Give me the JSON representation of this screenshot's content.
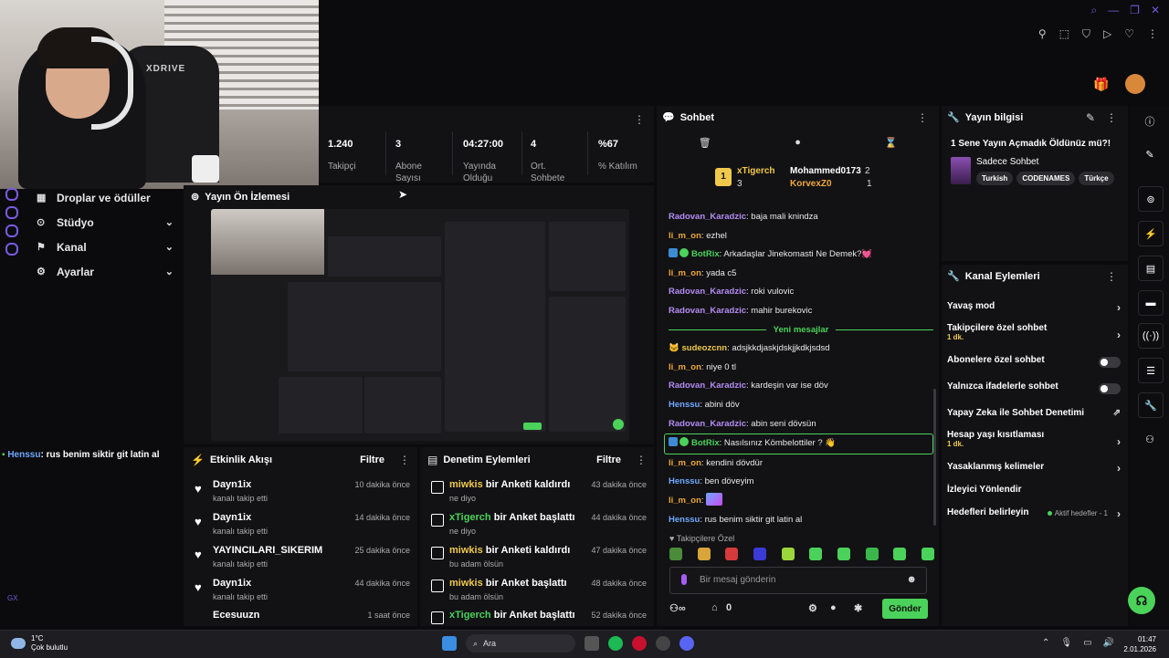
{
  "webcam": {
    "chair_text": "XDRIVE"
  },
  "nav": {
    "items": [
      {
        "label": "Droplar ve ödüller",
        "icon": "gift-icon"
      },
      {
        "label": "Stüdyo",
        "icon": "studio-icon"
      },
      {
        "label": "Kanal",
        "icon": "channel-icon"
      },
      {
        "label": "Ayarlar",
        "icon": "gear-icon"
      }
    ]
  },
  "overlay_chat": {
    "user": "Henssu",
    "message": "rus benim siktir git latin al"
  },
  "gx": "GX",
  "stats": [
    {
      "value": "1.240",
      "label": "Takipçi"
    },
    {
      "value": "3",
      "label": "Abone Sayısı"
    },
    {
      "value": "04:27:00",
      "label": "Yayında Olduğu"
    },
    {
      "value": "4",
      "label": "Ort. Sohbete"
    },
    {
      "value": "%67",
      "label": "% Katılım"
    }
  ],
  "preview": {
    "title": "Yayın Ön İzlemesi"
  },
  "activity": {
    "title": "Etkinlik Akışı",
    "filter": "Filtre",
    "items": [
      {
        "name": "Dayn1ix",
        "sub": "kanalı takip etti",
        "time": "10 dakika önce"
      },
      {
        "name": "Dayn1ix",
        "sub": "kanalı takip etti",
        "time": "14 dakika önce"
      },
      {
        "name": "YAYINCILARI_SIKERIM",
        "sub": "kanalı takip etti",
        "time": "25 dakika önce"
      },
      {
        "name": "Dayn1ix",
        "sub": "kanalı takip etti",
        "time": "44 dakika önce"
      },
      {
        "name": "Ecesuuzn",
        "sub": "",
        "time": "1 saat önce"
      }
    ]
  },
  "moderation": {
    "title": "Denetim Eylemleri",
    "filter": "Filtre",
    "items": [
      {
        "user": "miwkis",
        "action": "bir Anketi kaldırdı",
        "sub": "ne diyo",
        "time": "43 dakika önce",
        "color": "#f0c94c"
      },
      {
        "user": "xTigerch",
        "action": "bir Anket başlattı",
        "sub": "ne diyo",
        "time": "44 dakika önce",
        "color": "#4bd25a"
      },
      {
        "user": "miwkis",
        "action": "bir Anketi kaldırdı",
        "sub": "bu adam ölsün",
        "time": "47 dakika önce",
        "color": "#f0c94c"
      },
      {
        "user": "miwkis",
        "action": "bir Anket başlattı",
        "sub": "bu adam ölsün",
        "time": "48 dakika önce",
        "color": "#f0c94c"
      },
      {
        "user": "xTigerch",
        "action": "bir Anket başlattı",
        "sub": "",
        "time": "52 dakika önce",
        "color": "#4bd25a"
      }
    ]
  },
  "chat": {
    "title": "Sohbet",
    "leaderboard": {
      "first": {
        "name": "xTigerch",
        "count": "3"
      },
      "second": {
        "name": "Mohammed0173",
        "count": "2"
      },
      "third": {
        "name": "KorvexZ0",
        "count": "1"
      }
    },
    "new_messages_label": "Yeni mesajlar",
    "messages": [
      {
        "user": "Radovan_Karadzic",
        "text": "baja mali knindza",
        "color": "#b68cf5"
      },
      {
        "user": "li_m_on",
        "text": "ezhel",
        "color": "#f0a83c"
      },
      {
        "user": "BotRix",
        "text": "Arkadaşlar Jinekomasti Ne Demek?💓",
        "color": "#4bd25a",
        "bot": true
      },
      {
        "user": "li_m_on",
        "text": "yada c5",
        "color": "#f0a83c"
      },
      {
        "user": "Radovan_Karadzic",
        "text": "roki vulovic",
        "color": "#b68cf5"
      },
      {
        "user": "Radovan_Karadzic",
        "text": "mahir burekovic",
        "color": "#b68cf5"
      },
      {
        "divider": true
      },
      {
        "user": "sudeozcnn",
        "text": "adsjkkdjaskjdskjjkdkjsdsd",
        "color": "#f0c94c"
      },
      {
        "user": "li_m_on",
        "text": "niye 0 tl",
        "color": "#f0a83c"
      },
      {
        "user": "Radovan_Karadzic",
        "text": "kardeşin var ise döv",
        "color": "#b68cf5"
      },
      {
        "user": "Henssu",
        "text": "abini döv",
        "color": "#6fa8ff"
      },
      {
        "user": "Radovan_Karadzic",
        "text": "abin seni dövsün",
        "color": "#b68cf5"
      },
      {
        "user": "BotRix",
        "text": "Nasılsınız Kömbelottiler ? 👋",
        "color": "#4bd25a",
        "bot": true,
        "highlight": true
      },
      {
        "user": "li_m_on",
        "text": "kendini dövdür",
        "color": "#f0a83c"
      },
      {
        "user": "Henssu",
        "text": "ben döveyim",
        "color": "#6fa8ff"
      },
      {
        "user": "li_m_on",
        "text": "",
        "color": "#f0a83c"
      },
      {
        "user": "Henssu",
        "text": "rus benim siktir git latin al",
        "color": "#6fa8ff"
      }
    ],
    "emotes_label": "Takipçilere Özel",
    "input_placeholder": "Bir mesaj gönderin",
    "bottom_count": "0",
    "send_label": "Gönder"
  },
  "stream_info": {
    "title": "Yayın bilgisi",
    "stream_title": "1 Sene Yayın Açmadık Öldünüz mü?!",
    "category": "Sadece Sohbet",
    "tags": [
      "Turkish",
      "CODENAMES",
      "Türkçe"
    ]
  },
  "channel_actions": {
    "title": "Kanal Eylemleri",
    "items": [
      {
        "label": "Yavaş mod",
        "sub": "",
        "control": "chevron"
      },
      {
        "label": "Takipçilere özel sohbet",
        "sub": "1 dk.",
        "control": "chevron"
      },
      {
        "label": "Abonelere özel sohbet",
        "sub": "",
        "control": "toggle"
      },
      {
        "label": "Yalnızca ifadelerle sohbet",
        "sub": "",
        "control": "toggle"
      },
      {
        "label": "Yapay Zeka ile Sohbet Denetimi",
        "sub": "",
        "control": "external"
      },
      {
        "label": "Hesap yaşı kısıtlaması",
        "sub": "1 dk.",
        "control": "chevron"
      },
      {
        "label": "Yasaklanmış kelimeler",
        "sub": "",
        "control": "chevron"
      },
      {
        "label": "İzleyici Yönlendir",
        "sub": "",
        "control": "none"
      },
      {
        "label": "Hedefleri belirleyin",
        "sub": "",
        "control": "chevron",
        "extra": "Aktif hedefler - 1"
      }
    ]
  },
  "taskbar": {
    "temp": "1°C",
    "weather": "Çok bulutlu",
    "search": "Ara",
    "time": "01:47",
    "date": "2.01.2026"
  },
  "colors": {
    "accent": "#4bd25a",
    "panel": "#121214",
    "background": "#0b0b0d"
  }
}
